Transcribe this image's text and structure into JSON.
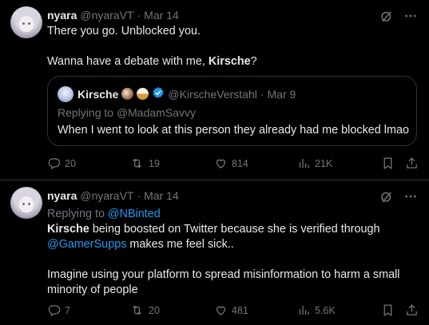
{
  "tweets": [
    {
      "author": {
        "name": "nyara",
        "handle": "@nyaraVT",
        "date": "Mar 14"
      },
      "text_line1": "There you go. Unblocked you.",
      "text_line2_prefix": "Wanna have a debate with me, ",
      "text_line2_bold": "Kirsche",
      "text_line2_suffix": "?",
      "quote": {
        "name": "Kirsche",
        "handle": "@KirscheVerstahl",
        "date": "Mar 9",
        "replying_prefix": "Replying to ",
        "replying_to": "@MadamSavvy",
        "text": "When I went to look at this person they already had me blocked lmao"
      },
      "stats": {
        "replies": "20",
        "retweets": "19",
        "likes": "814",
        "views": "21K"
      }
    },
    {
      "author": {
        "name": "nyara",
        "handle": "@nyaraVT",
        "date": "Mar 14"
      },
      "replying_prefix": "Replying to ",
      "replying_to": "@NBinted",
      "p1_bold": "Kirsche",
      "p1_rest": " being boosted on Twitter because she is verified through",
      "p1_link": "@GamerSupps",
      "p1_end": " makes me feel sick..",
      "p2": "Imagine using your platform to spread misinformation to harm a small",
      "p2_line2": "minority of people",
      "stats": {
        "replies": "7",
        "retweets": "20",
        "likes": "481",
        "views": "5.6K"
      }
    }
  ],
  "separator": "·",
  "colors": {
    "background": "#000000",
    "text": "#e7e9ea",
    "muted": "#71767b",
    "link": "#1d9bf0",
    "border": "#2f3336"
  },
  "icons": [
    "grok-icon",
    "more-icon",
    "reply-icon",
    "retweet-icon",
    "like-icon",
    "views-icon",
    "bookmark-icon",
    "share-icon",
    "verified-icon"
  ]
}
